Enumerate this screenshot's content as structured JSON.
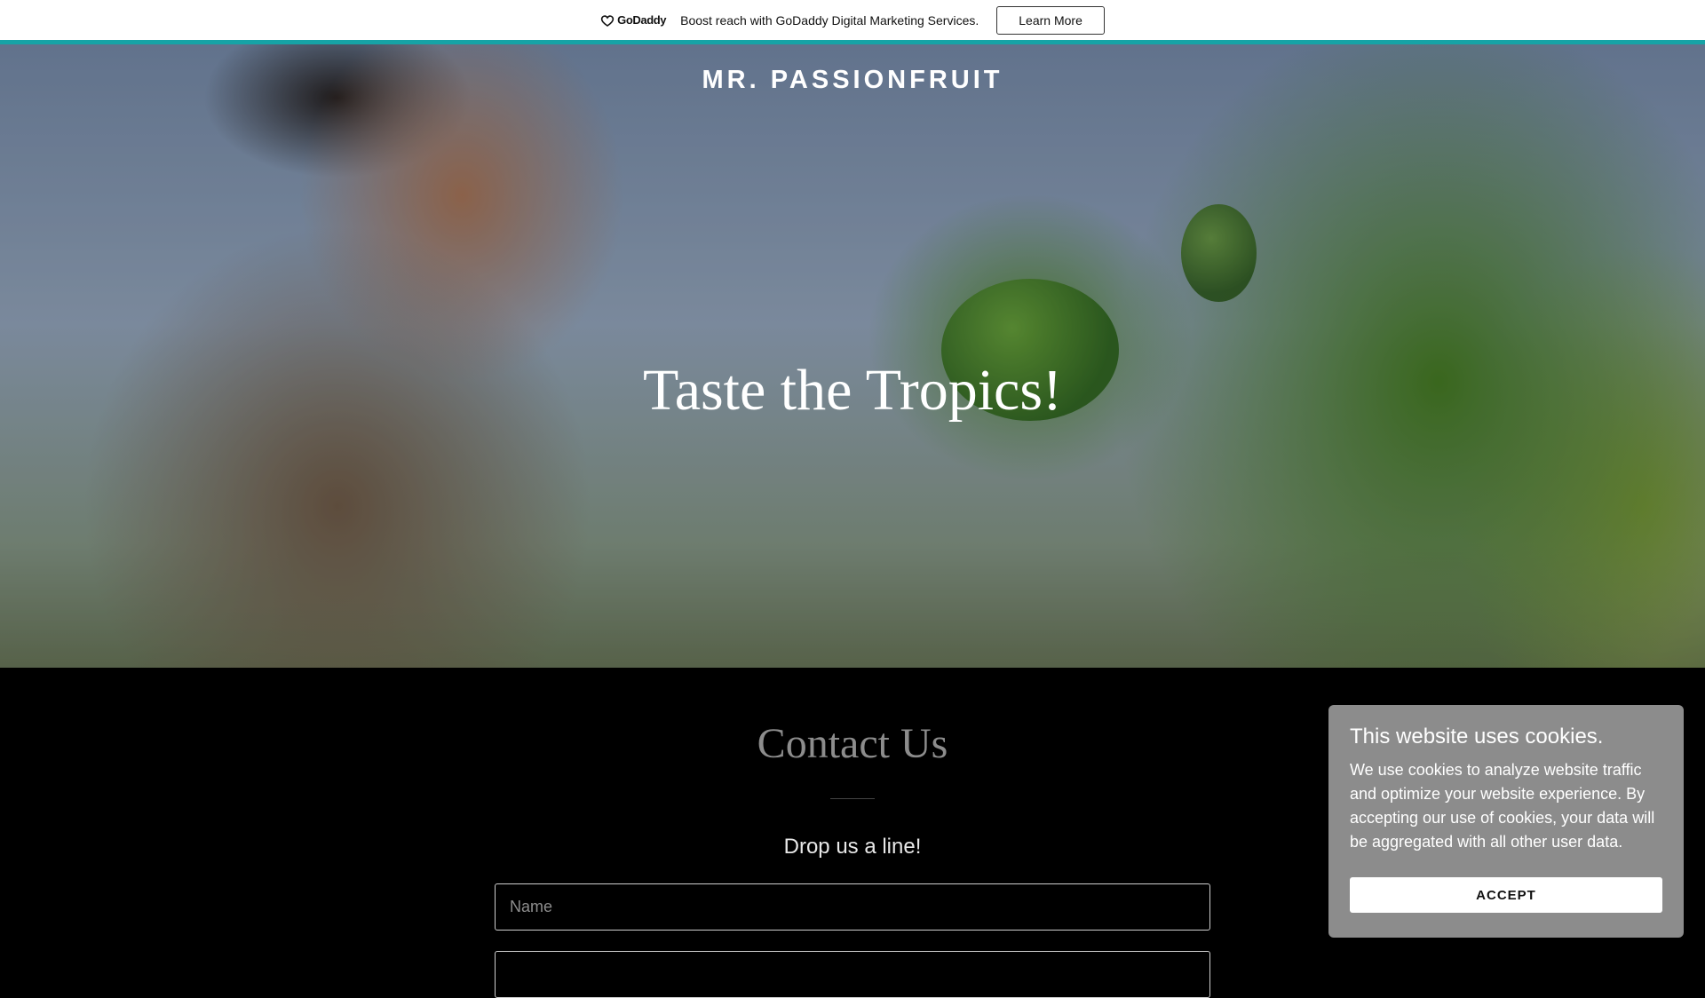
{
  "promo": {
    "logo_text": "GoDaddy",
    "message": "Boost reach with GoDaddy Digital Marketing Services.",
    "button_label": "Learn More",
    "accent_color": "#16a3a6"
  },
  "hero": {
    "brand": "MR. PASSIONFRUIT",
    "title": "Taste the Tropics!"
  },
  "contact": {
    "title": "Contact Us",
    "subtitle": "Drop us a line!",
    "name_placeholder": "Name",
    "email_placeholder": ""
  },
  "cookie_banner": {
    "title": "This website uses cookies.",
    "text": "We use cookies to analyze website traffic and optimize your website experience. By accepting our use of cookies, your data will be aggregated with all other user data.",
    "button_label": "ACCEPT"
  }
}
